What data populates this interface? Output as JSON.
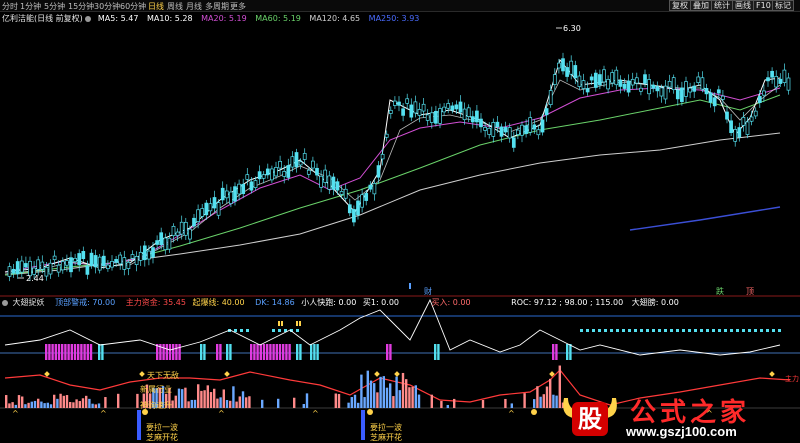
{
  "toolbar": {
    "periods": [
      "分时",
      "1分钟",
      "5分钟",
      "15分钟",
      "30分钟",
      "60分钟",
      "日线",
      "周线",
      "月线",
      "多周期",
      "更多"
    ],
    "active_period": "日线",
    "right_buttons": [
      "复权",
      "叠加",
      "统计",
      "画线",
      "F10",
      "标记"
    ]
  },
  "main_chart": {
    "name": "亿利洁能(日线 前复权)",
    "ma": [
      {
        "label": "MA5: 5.47",
        "color": "#ffffff"
      },
      {
        "label": "MA10: 5.28",
        "color": "#ffffff"
      },
      {
        "label": "MA20: 5.19",
        "color": "#d24fd4"
      },
      {
        "label": "MA60: 5.19",
        "color": "#6ad26a"
      },
      {
        "label": "MA120: 4.65",
        "color": "#d0d0d0"
      },
      {
        "label": "MA250: 3.93",
        "color": "#4a6cff"
      }
    ],
    "high_label": "6.30",
    "low_label": "2.44",
    "markers": [
      "财",
      "跌",
      "顶"
    ]
  },
  "sub_chart": {
    "indicator": "大翅捉妖",
    "items": [
      {
        "label": "顶部警戒: 70.00",
        "color": "#5aa0ff"
      },
      {
        "label": "主力资金: 35.45",
        "color": "#ff4a4a"
      },
      {
        "label": "起爆线: 40.00",
        "color": "#ffd24a"
      },
      {
        "label": "DK: 14.86",
        "color": "#5aa0ff"
      },
      {
        "label": "小人快跑: 0.00",
        "color": "#ffffff"
      },
      {
        "label": "买1: 0.00",
        "color": "#ffffff"
      },
      {
        "label": "买入: 0.00",
        "color": "#ff6a6a"
      },
      {
        "label": "ROC: 97.12 ; 98.00 ; 115.00",
        "color": "#ffffff"
      },
      {
        "label": "大翅膀: 0.00",
        "color": "#ffffff"
      }
    ],
    "annotations": [
      "天下无敌",
      "新属行业",
      "神驹速升",
      "要拉一波",
      "芝麻开花",
      "要拉一波",
      "芝麻开花"
    ],
    "right_label": "主力"
  },
  "watermark": {
    "icon_char": "股",
    "title": "公式之家",
    "url": "www.gszj100.com"
  },
  "colors": {
    "up": "#54e0f0",
    "down": "#54e0f0",
    "ma5": "#ffffff",
    "ma20": "#d24fd4",
    "ma60": "#6ad26a",
    "ma120": "#d0d0d0",
    "ma250": "#3b4fd6",
    "magenta_bar": "#e03ce0",
    "cyan_bar": "#54e0f0",
    "red_line": "#ff3a3a",
    "pink_bar": "#ff8a8a",
    "blue_bar": "#6aa8ff"
  }
}
